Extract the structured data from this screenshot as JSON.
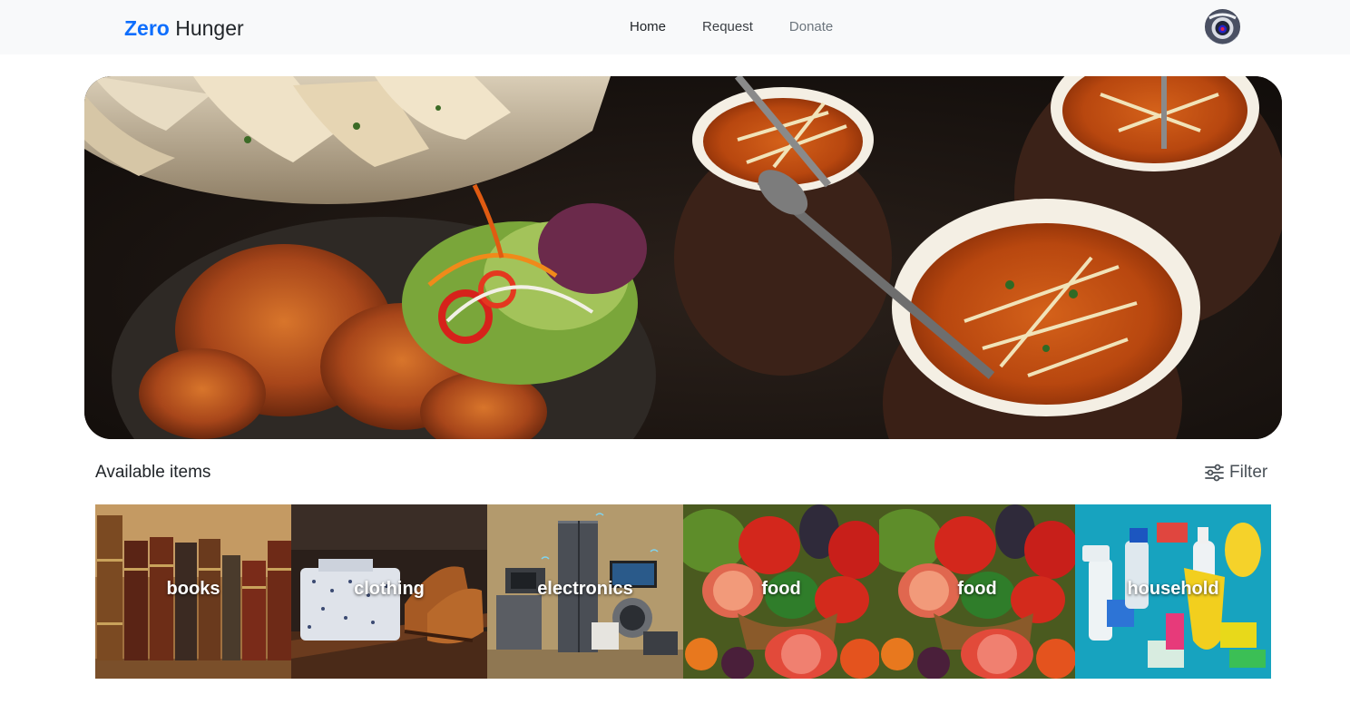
{
  "navbar": {
    "brand_accent": "Zero",
    "brand_rest": "Hunger",
    "links": [
      "Home",
      "Request",
      "Donate"
    ]
  },
  "hero": {
    "icon": "food-banner-image"
  },
  "section": {
    "title": "Available items",
    "filter_label": "Filter"
  },
  "categories": [
    "books",
    "clothing",
    "electronics",
    "food",
    "food",
    "household"
  ],
  "colors": {
    "brand": "#0d6efd",
    "navbar_bg": "#f8f9fa",
    "text": "#212529"
  }
}
